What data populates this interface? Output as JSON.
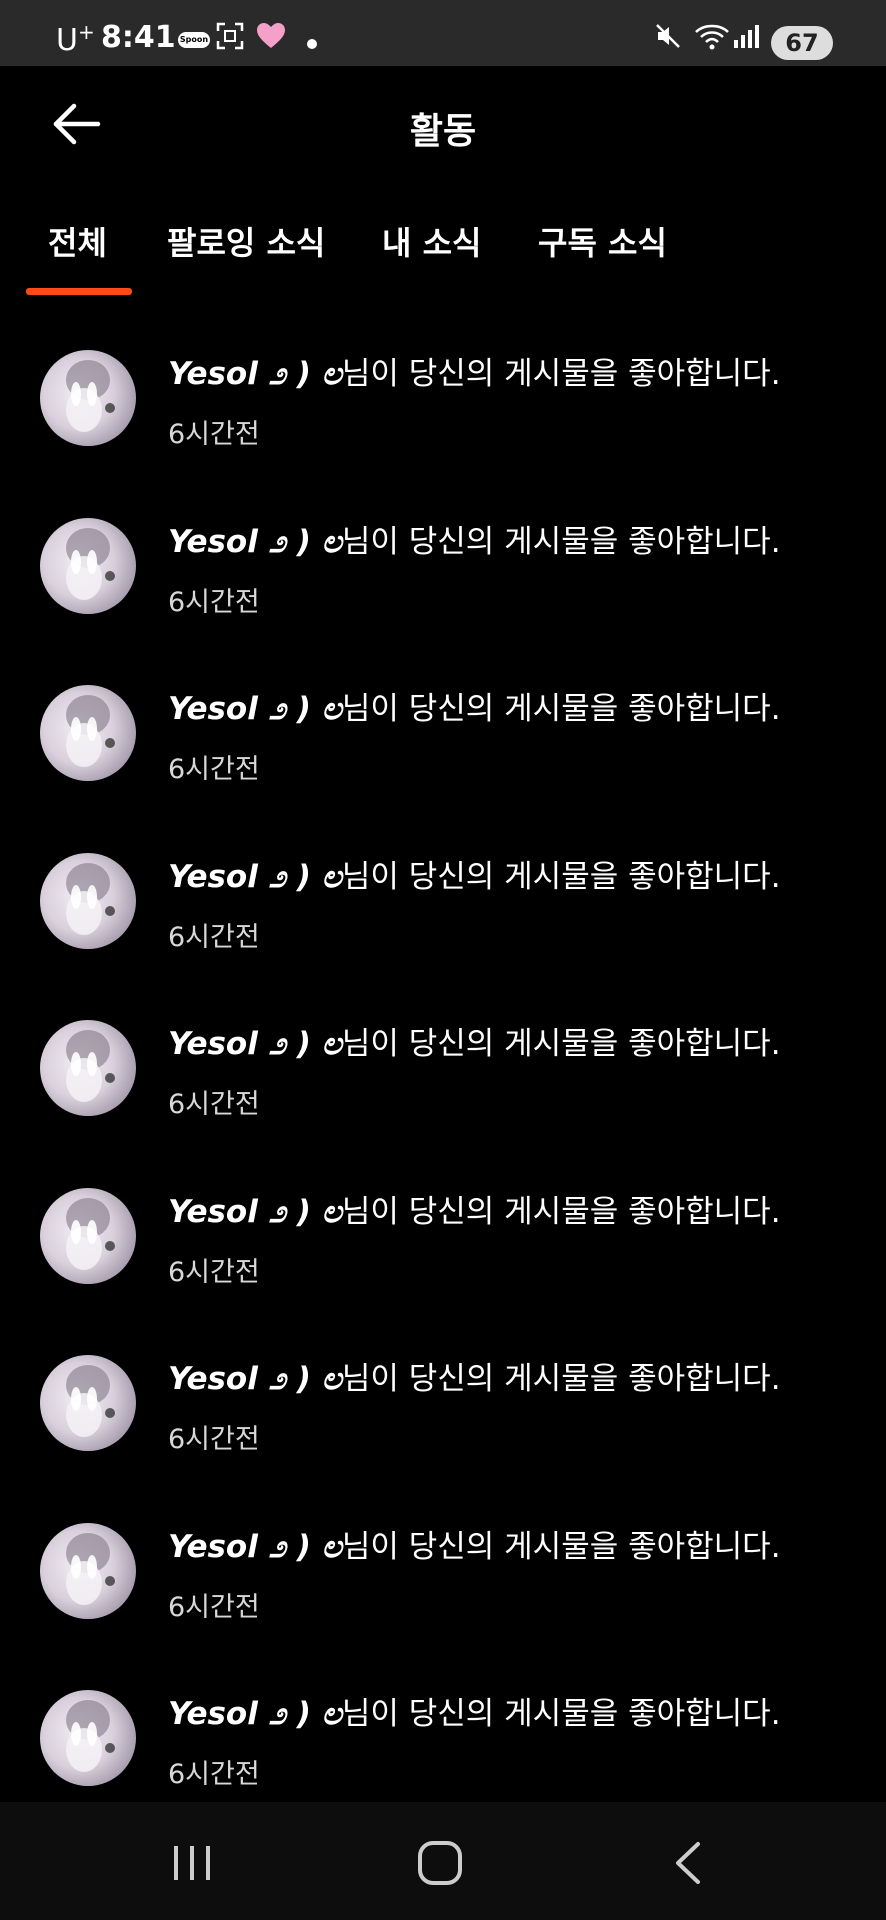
{
  "status_bar": {
    "carrier": "U",
    "carrier_sup": "+",
    "time": "8:41",
    "spoon_label": "Spoon",
    "battery": "67"
  },
  "header": {
    "title": "활동"
  },
  "tabs": [
    {
      "label": "전체",
      "active": true
    },
    {
      "label": "팔로잉 소식",
      "active": false
    },
    {
      "label": "내 소식",
      "active": false
    },
    {
      "label": "구독 소식",
      "active": false
    }
  ],
  "activities": [
    {
      "username": "Yesol ೨ ) ಲ",
      "message": "님이 당신의 게시물을 좋아합니다.",
      "time": "6시간전"
    },
    {
      "username": "Yesol ೨ ) ಲ",
      "message": "님이 당신의 게시물을 좋아합니다.",
      "time": "6시간전"
    },
    {
      "username": "Yesol ೨ ) ಲ",
      "message": "님이 당신의 게시물을 좋아합니다.",
      "time": "6시간전"
    },
    {
      "username": "Yesol ೨ ) ಲ",
      "message": "님이 당신의 게시물을 좋아합니다.",
      "time": "6시간전"
    },
    {
      "username": "Yesol ೨ ) ಲ",
      "message": "님이 당신의 게시물을 좋아합니다.",
      "time": "6시간전"
    },
    {
      "username": "Yesol ೨ ) ಲ",
      "message": "님이 당신의 게시물을 좋아합니다.",
      "time": "6시간전"
    },
    {
      "username": "Yesol ೨ ) ಲ",
      "message": "님이 당신의 게시물을 좋아합니다.",
      "time": "6시간전"
    },
    {
      "username": "Yesol ೨ ) ಲ",
      "message": "님이 당신의 게시물을 좋아합니다.",
      "time": "6시간전"
    },
    {
      "username": "Yesol ೨ ) ಲ",
      "message": "님이 당신의 게시물을 좋아합니다.",
      "time": "6시간전"
    }
  ],
  "colors": {
    "accent": "#ff4a14",
    "background": "#000000",
    "status_bar": "#2a2a2a"
  },
  "icons": {
    "back": "arrow-left-icon",
    "nav_recents": "recents-icon",
    "nav_home": "home-icon",
    "nav_back": "chevron-left-icon"
  }
}
